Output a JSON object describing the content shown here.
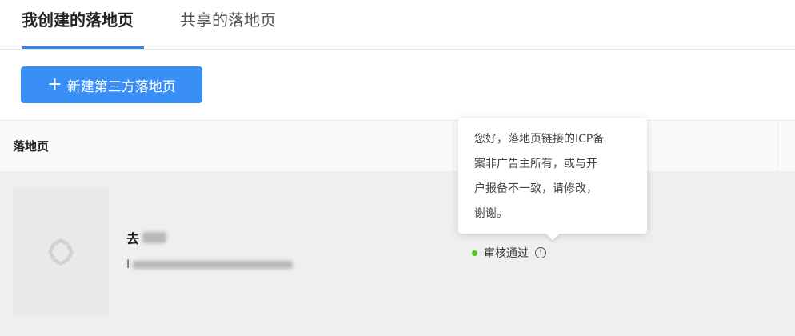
{
  "tabs": [
    {
      "label": "我创建的落地页",
      "active": true
    },
    {
      "label": "共享的落地页",
      "active": false
    }
  ],
  "create_button": {
    "label": "新建第三方落地页",
    "icon": "plus-icon"
  },
  "table": {
    "headers": [
      "落地页"
    ],
    "rows": [
      {
        "name_visible": "去",
        "id_visible": "I",
        "thumbnail_icon": "placeholder-logo-icon",
        "status": "审核通过",
        "status_color": "#52c41a"
      }
    ]
  },
  "tooltip": {
    "lines": [
      "您好，落地页链接的ICP备",
      "案非广告主所有，或与开",
      "户报备不一致，请修改，",
      "谢谢。"
    ]
  },
  "colors": {
    "accent": "#3a8ff7",
    "success": "#52c41a"
  }
}
